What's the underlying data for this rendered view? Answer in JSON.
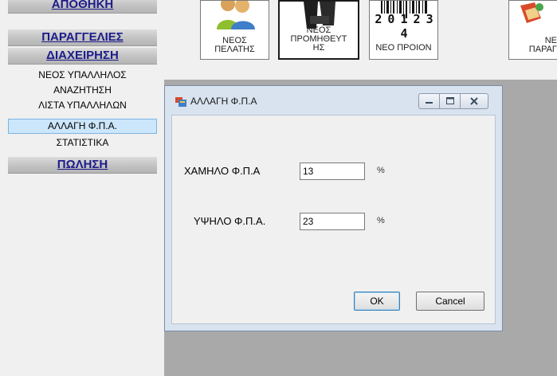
{
  "nav": {
    "apothiki": "ΑΠΟΘΗΚΗ",
    "paraggelies": "ΠΑΡΑΓΓΕΛΙΕΣ",
    "diaxeirisi": "ΔΙΑΧΕΙΡΗΣΗ",
    "items": [
      {
        "label": "ΝΕΟΣ ΥΠΑΛΛΗΛΟΣ"
      },
      {
        "label": "ΑΝΑΖΗΤΗΣΗ"
      },
      {
        "label": "ΛΙΣΤΑ ΥΠΑΛΛΗΛΩΝ"
      },
      {
        "label": "ΑΛΛΑΓΗ Φ.Π.Α.",
        "selected": true
      },
      {
        "label": "ΣΤΑΤΙΣΤΙΚΑ"
      }
    ],
    "polisi": "ΠΩΛΗΣΗ"
  },
  "toolbar": {
    "new_customer": "ΝΕΟΣ\nΠΕΛΑΤΗΣ",
    "new_supplier": "ΝΕΟΣ\nΠΡΟΜΗΘΕΥΤ\nΗΣ",
    "new_product": "ΝΕΟ ΠΡΟΙΟΝ",
    "new_order": "ΝΕ\nΠΑΡΑΓ",
    "barcode_digits": "2 0 1 2 3 4"
  },
  "dialog": {
    "title": "ΑΛΛΑΓΗ Φ.Π.Α",
    "low_vat_label": "ΧΑΜΗΛΟ Φ.Π.Α",
    "low_vat_value": "13",
    "high_vat_label": "ΥΨΗΛΟ Φ.Π.Α.",
    "high_vat_value": "23",
    "percent": "%",
    "ok": "OK",
    "cancel": "Cancel"
  },
  "icons": {
    "app": "form-icon",
    "minimize": "minimize-icon",
    "maximize": "maximize-icon",
    "close": "close-icon"
  },
  "colors": {
    "nav_header_text": "#1c1c8c",
    "selected_item_bg": "#cce6fb",
    "mdi_background": "#a9a9a9",
    "dialog_frame": "#d8e3ef"
  }
}
